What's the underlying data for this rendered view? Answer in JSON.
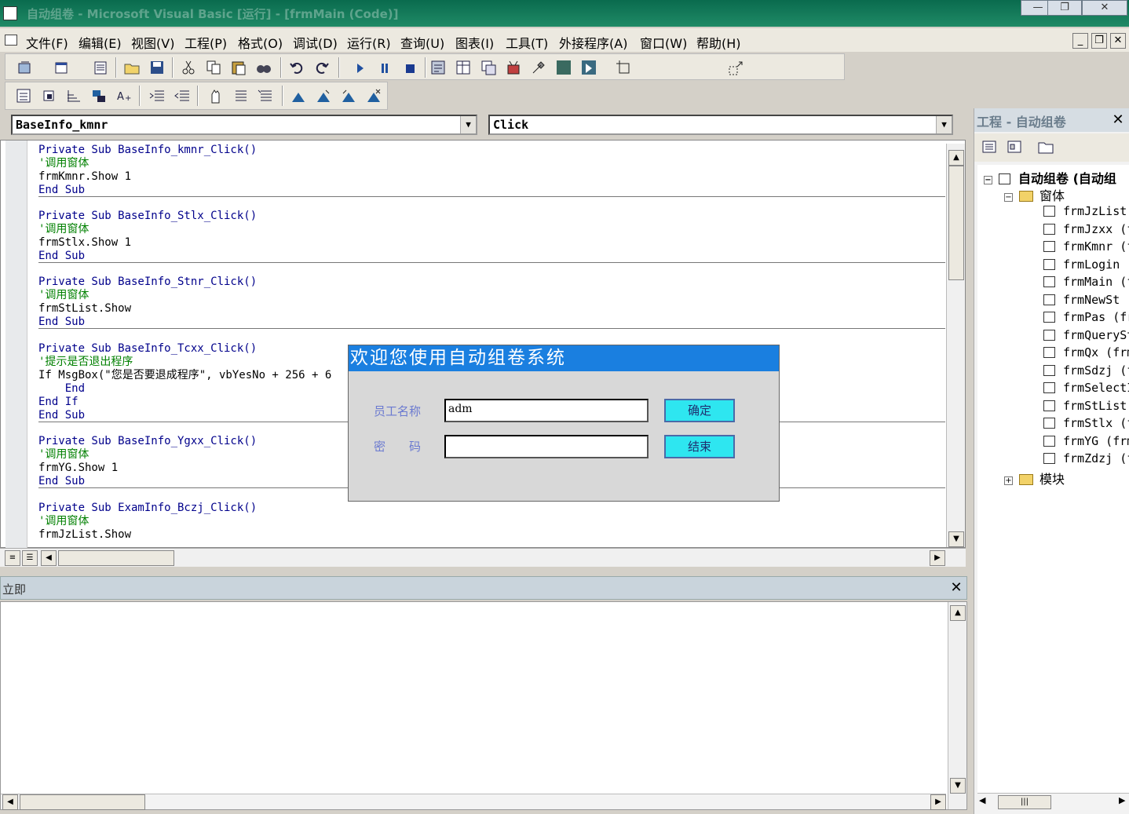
{
  "window": {
    "title": "自动组卷 - Microsoft Visual Basic [运行] - [frmMain (Code)]"
  },
  "menu": [
    "文件(F)",
    "编辑(E)",
    "视图(V)",
    "工程(P)",
    "格式(O)",
    "调试(D)",
    "运行(R)",
    "查询(U)",
    "图表(I)",
    "工具(T)",
    "外接程序(A)",
    "窗口(W)",
    "帮助(H)"
  ],
  "code_window": {
    "object_combo": "BaseInfo_kmnr",
    "procedure_combo": "Click",
    "procedures": [
      [
        "Private Sub BaseInfo_kmnr_Click()",
        "'调用窗体",
        "frmKmnr.Show 1",
        "End Sub"
      ],
      [
        "Private Sub BaseInfo_Stlx_Click()",
        "'调用窗体",
        "frmStlx.Show 1",
        "End Sub"
      ],
      [
        "Private Sub BaseInfo_Stnr_Click()",
        "'调用窗体",
        "frmStList.Show",
        "End Sub"
      ],
      [
        "Private Sub BaseInfo_Tcxx_Click()",
        "'提示是否退出程序",
        "If MsgBox(\"您是否要退成程序\", vbYesNo + 256 + 6",
        "    End",
        "End If",
        "End Sub"
      ],
      [
        "Private Sub BaseInfo_Ygxx_Click()",
        "'调用窗体",
        "frmYG.Show 1",
        "End Sub"
      ],
      [
        "Private Sub ExamInfo_Bczj_Click()",
        "'调用窗体",
        "frmJzList.Show"
      ]
    ]
  },
  "immediate": {
    "title": "立即"
  },
  "project": {
    "title": "工程 - 自动组卷",
    "root": "自动组卷 (自动组",
    "forms_folder": "窗体",
    "forms": [
      "frmJzList",
      "frmJzxx (f",
      "frmKmnr (f",
      "frmLogin (",
      "frmMain (f",
      "frmNewSt (",
      "frmPas (fr",
      "frmQuerySt",
      "frmQx (frm",
      "frmSdzj (f",
      "frmSelectI",
      "frmStList",
      "frmStlx (f",
      "frmYG (frm",
      "frmZdzj (f"
    ],
    "modules_folder": "模块"
  },
  "dialog": {
    "title": "欢迎您使用自动组卷系统",
    "username_label": "员工名称",
    "password_label": "密　　码",
    "username_value": "adm",
    "password_value": "",
    "ok_label": "确定",
    "exit_label": "结束"
  }
}
